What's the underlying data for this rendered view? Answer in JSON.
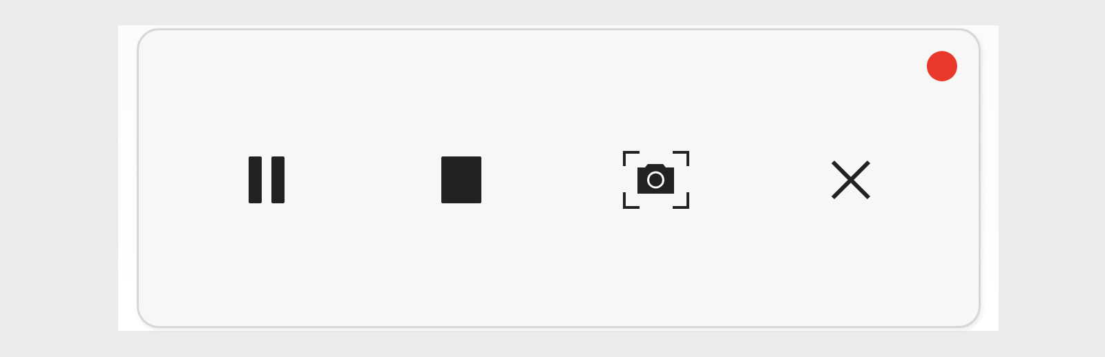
{
  "recording_indicator": {
    "color": "#e8392b"
  },
  "buttons": [
    {
      "kind": "pause"
    },
    {
      "kind": "stop"
    },
    {
      "kind": "screenshot"
    },
    {
      "kind": "close"
    }
  ]
}
